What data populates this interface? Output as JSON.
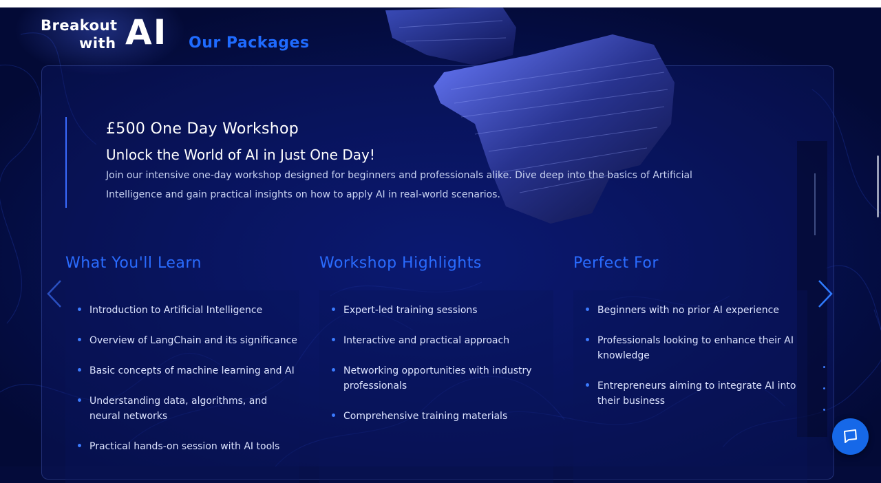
{
  "brand": {
    "line1": "Breakout",
    "line2": "with",
    "ai": "AI"
  },
  "page_heading": "Our Packages",
  "package": {
    "price_title": "£500 One Day Workshop",
    "tagline": "Unlock the World of AI in Just One Day!",
    "description": "Join our intensive one-day workshop designed for beginners and professionals alike. Dive deep into the basics of Artificial Intelligence and gain practical insights on how to apply AI in real-world scenarios."
  },
  "columns": [
    {
      "heading": "What You'll Learn",
      "items": [
        "Introduction to Artificial Intelligence",
        "Overview of LangChain and its significance",
        "Basic concepts of machine learning and AI",
        "Understanding data, algorithms, and neural networks",
        "Practical hands-on session with AI tools"
      ]
    },
    {
      "heading": "Workshop Highlights",
      "items": [
        "Expert-led training sessions",
        "Interactive and practical approach",
        "Networking opportunities with industry professionals",
        "Comprehensive training materials"
      ]
    },
    {
      "heading": "Perfect For",
      "items": [
        "Beginners with no prior AI experience",
        "Professionals looking to enhance their AI knowledge",
        "Entrepreneurs aiming to integrate AI into their business"
      ]
    }
  ],
  "icons": {
    "prev": "chevron-left-icon",
    "next": "chevron-right-icon",
    "chat": "chat-icon"
  },
  "colors": {
    "background": "#040b3a",
    "accent": "#1f6bff",
    "chat_button": "#1668e8"
  }
}
